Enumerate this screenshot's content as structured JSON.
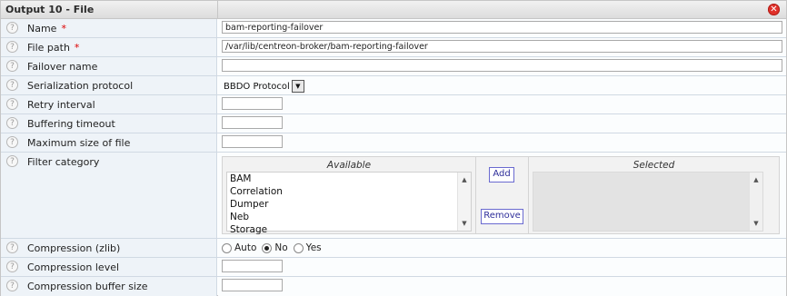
{
  "header": {
    "title": "Output 10 - File",
    "close_icon": "close-icon"
  },
  "fields": {
    "name": {
      "label": "Name",
      "required_mark": "*",
      "value": "bam-reporting-failover"
    },
    "file_path": {
      "label": "File path",
      "required_mark": "*",
      "value": "/var/lib/centreon-broker/bam-reporting-failover"
    },
    "failover_name": {
      "label": "Failover name",
      "value": ""
    },
    "serialization": {
      "label": "Serialization protocol",
      "value": "BBDO Protocol"
    },
    "retry_interval": {
      "label": "Retry interval",
      "value": ""
    },
    "buffering_timeout": {
      "label": "Buffering timeout",
      "value": ""
    },
    "max_file_size": {
      "label": "Maximum size of file",
      "value": ""
    },
    "filter_category": {
      "label": "Filter category",
      "available_header": "Available",
      "selected_header": "Selected",
      "available_items": [
        "BAM",
        "Correlation",
        "Dumper",
        "Neb",
        "Storage"
      ],
      "selected_items": [],
      "add_label": "Add",
      "remove_label": "Remove"
    },
    "compression": {
      "label": "Compression (zlib)",
      "options": [
        "Auto",
        "No",
        "Yes"
      ],
      "selected": "No"
    },
    "compression_level": {
      "label": "Compression level",
      "value": ""
    },
    "compression_buffer": {
      "label": "Compression buffer size",
      "value": ""
    }
  },
  "help_glyph": "?"
}
